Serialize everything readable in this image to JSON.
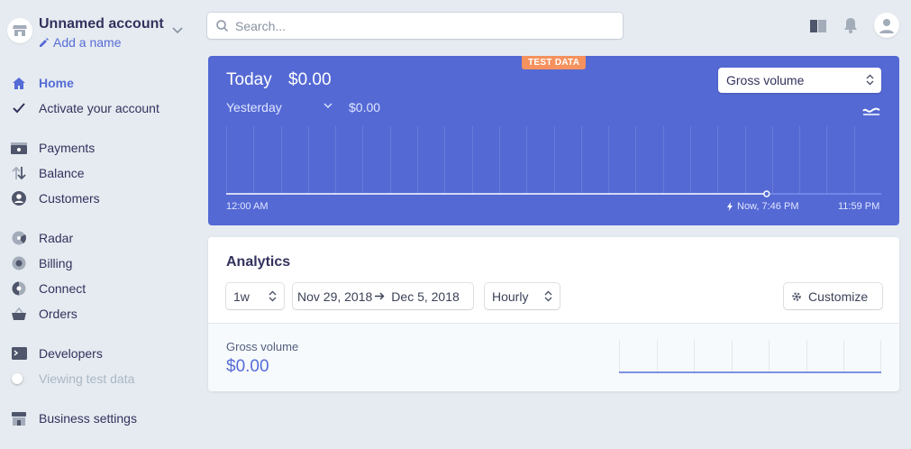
{
  "account": {
    "name": "Unnamed account",
    "add_name": "Add a name"
  },
  "search": {
    "placeholder": "Search..."
  },
  "nav": {
    "home": "Home",
    "activate": "Activate your account",
    "payments": "Payments",
    "balance": "Balance",
    "customers": "Customers",
    "radar": "Radar",
    "billing": "Billing",
    "connect": "Connect",
    "orders": "Orders",
    "developers": "Developers",
    "viewing_test": "Viewing test data",
    "business_settings": "Business settings"
  },
  "hero": {
    "badge": "TEST DATA",
    "today_label": "Today",
    "today_value": "$0.00",
    "compare_label": "Yesterday",
    "compare_value": "$0.00",
    "metric": "Gross volume",
    "x_start": "12:00 AM",
    "x_now": "Now, 7:46 PM",
    "x_end": "11:59 PM",
    "now_fraction": 0.825
  },
  "analytics": {
    "title": "Analytics",
    "range": "1w",
    "date_start": "Nov 29, 2018",
    "date_end": "Dec 5, 2018",
    "interval": "Hourly",
    "customize": "Customize",
    "metric_label": "Gross volume",
    "metric_value": "$0.00"
  },
  "colors": {
    "accent": "#556cd6",
    "hero_bg": "#5469d4",
    "badge": "#f5925e"
  }
}
